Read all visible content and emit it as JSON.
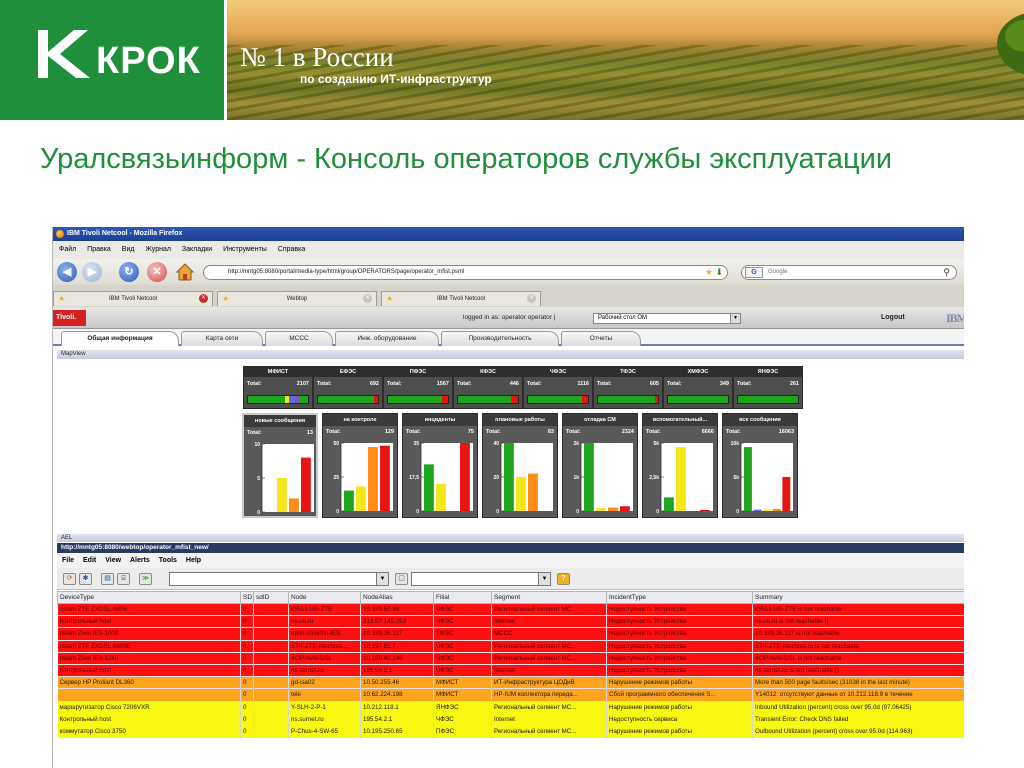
{
  "banner": {
    "logo_text": "КРОК",
    "headline": "№ 1 в России",
    "subline": "по созданию ИТ-инфраструктур"
  },
  "slide_title": "Уралсвязьинформ - Консоль операторов службы эксплуатации",
  "browser": {
    "window_title": "IBM Tivoli Netcool - Mozilla Firefox",
    "menu": [
      "Файл",
      "Правка",
      "Вид",
      "Журнал",
      "Закладки",
      "Инструменты",
      "Справка"
    ],
    "url": "http://mntg05:8080/portal/media-type/html/group/OPERATORS/page/operator_mfist.psml",
    "search_placeholder": "Google",
    "search_badge": "G",
    "tabs": [
      "IBM Tivoli Netcool",
      "Webtop",
      "IBM Tivoli Netcool"
    ]
  },
  "tivoli": {
    "logo": "Tivoli.",
    "login_text": "logged in as: operator operator  |",
    "desktop_select": "Рабочий стол ОМ",
    "logout": "Logout",
    "ibm": "IBM"
  },
  "portal_tabs": [
    "Общая информация",
    "Карта сети",
    "МССС",
    "Инж. оборудование",
    "Производительность",
    "Отчеты"
  ],
  "mapview_title": "MapView",
  "summary_tiles": [
    {
      "name": "МФИСТ",
      "label": "Total:",
      "total": "2107"
    },
    {
      "name": "ЕФЭС",
      "label": "Total:",
      "total": "692"
    },
    {
      "name": "ПФЭС",
      "label": "Total:",
      "total": "1567"
    },
    {
      "name": "КФЭС",
      "label": "Total:",
      "total": "446"
    },
    {
      "name": "ЧФЭС",
      "label": "Total:",
      "total": "1116"
    },
    {
      "name": "ТФЭС",
      "label": "Total:",
      "total": "605"
    },
    {
      "name": "ХМФЭС",
      "label": "Total:",
      "total": "349"
    },
    {
      "name": "ЯНФЭС",
      "label": "Total:",
      "total": "261"
    }
  ],
  "severity_colors": {
    "green": "#1ea61e",
    "yellow": "#f5e61a",
    "orange": "#ff8c14",
    "red": "#e61414",
    "blue": "#5a6ee6",
    "purple": "#9050c0"
  },
  "chart_data": [
    {
      "type": "bar",
      "title": "новые сообщения",
      "total_label": "Total:",
      "total": "13",
      "y_ticks": [
        "10",
        "5",
        "0"
      ],
      "ylim": [
        0,
        10
      ],
      "categories": [
        "green",
        "yellow",
        "orange",
        "red"
      ],
      "values": [
        0,
        5,
        2,
        8
      ]
    },
    {
      "type": "bar",
      "title": "на контроле",
      "total_label": "Total:",
      "total": "129",
      "y_ticks": [
        "50",
        "25",
        "0"
      ],
      "ylim": [
        0,
        50
      ],
      "categories": [
        "green",
        "yellow",
        "orange",
        "red"
      ],
      "values": [
        15,
        18,
        47,
        48
      ]
    },
    {
      "type": "bar",
      "title": "инциденты",
      "total_label": "Total:",
      "total": "75",
      "y_ticks": [
        "35",
        "17,5",
        "0"
      ],
      "ylim": [
        0,
        35
      ],
      "categories": [
        "green",
        "yellow",
        "orange",
        "red"
      ],
      "values": [
        24,
        14,
        0,
        35
      ]
    },
    {
      "type": "bar",
      "title": "плановые работы",
      "total_label": "Total:",
      "total": "83",
      "y_ticks": [
        "40",
        "20",
        "0"
      ],
      "ylim": [
        0,
        40
      ],
      "categories": [
        "green",
        "yellow",
        "orange",
        "red"
      ],
      "values": [
        40,
        20,
        22,
        0
      ]
    },
    {
      "type": "bar",
      "title": "отладка СМ",
      "total_label": "Total:",
      "total": "2324",
      "y_ticks": [
        "2k",
        "1k",
        "0"
      ],
      "ylim": [
        0,
        2000
      ],
      "categories": [
        "green",
        "yellow",
        "orange",
        "red"
      ],
      "values": [
        2000,
        80,
        100,
        140
      ]
    },
    {
      "type": "bar",
      "title": "вспомогательный...",
      "total_label": "Total:",
      "total": "6666",
      "y_ticks": [
        "5k",
        "2,5k",
        "0"
      ],
      "ylim": [
        0,
        5000
      ],
      "categories": [
        "green",
        "yellow",
        "orange",
        "red"
      ],
      "values": [
        1000,
        4700,
        0,
        50
      ]
    },
    {
      "type": "bar",
      "title": "все сообщения",
      "total_label": "Total:",
      "total": "16063",
      "y_ticks": [
        "10k",
        "5k",
        "0"
      ],
      "ylim": [
        0,
        10000
      ],
      "categories": [
        "green",
        "blue",
        "yellow",
        "orange",
        "red"
      ],
      "values": [
        9400,
        200,
        200,
        300,
        5000
      ]
    }
  ],
  "ael": {
    "title": "AEL",
    "url": "http://mntg05:8080/webtop/operator_mfist_new/",
    "menu": [
      "File",
      "Edit",
      "View",
      "Alerts",
      "Tools",
      "Help"
    ],
    "columns": [
      "DeviceType",
      "SD",
      "sdID",
      "Node",
      "NodeAlias",
      "Filial",
      "Segment",
      "IncidentType",
      "Summary"
    ],
    "rows": [
      {
        "severity": "red",
        "cells": [
          "dslam ZTE ZXDSL-9806",
          "0",
          "",
          "KRA-LUG-ZTE",
          "10.199.50.98",
          "ЧФЭС",
          "Региональный сегмент МС...",
          "Недоступность Устройства",
          "KRA-LUG-ZTE is not reachable"
        ]
      },
      {
        "severity": "red",
        "cells": [
          "Контрольный host",
          "0",
          "",
          "ns.uu.ru",
          "213.57.145.253",
          "ЧФЭС",
          "Internet",
          "Недоступность Устройства",
          "ns.uu.ru is not reachable ()"
        ]
      },
      {
        "severity": "red",
        "cells": [
          "dslam Zixel IES-1000",
          "0",
          "",
          "upsh-smurtlin-IES...",
          "10.199.36.117",
          "ТФЭС",
          "МССС",
          "Недоступность Устройства",
          "10.199.36.117 is not reachable"
        ]
      },
      {
        "severity": "red",
        "cells": [
          "dslam ZTE ZXDSL-9606E",
          "0",
          "",
          "STK-ZTE-Mezhrev...",
          "10.197.81.7",
          "ЧФЭС",
          "Региональный сегмент МС...",
          "Недоступность Устройства",
          "STK-ZTE-Mezhrev.ru is not reachable"
        ]
      },
      {
        "severity": "red",
        "cells": [
          "dslam Zixel IES-1248",
          "0",
          "",
          "AOP-NAV-DSL",
          "10.199.40.146",
          "ЧФЭС",
          "Региональный сегмент МС...",
          "Недоступность Устройства",
          "AOP-NAV-DSL is not reachable"
        ]
      },
      {
        "severity": "red",
        "cells": [
          "Контрольный host",
          "0",
          "",
          "ns.surnet.ru",
          "195.54.2.1",
          "ЧФЭС",
          "Internet",
          "Недоступность Устройства",
          "ns.surnet.ru is not reachable ()"
        ]
      },
      {
        "severity": "orange",
        "cells": [
          "Сервер HP Proliant DL360",
          "0",
          "",
          "gd-isa02",
          "10.50.255.46",
          "МФИСТ",
          "ИТ-Инфраструктура ЦОДиВ",
          "Нарушение режимов работы",
          "More than 500 page faults/sec (31038 in the last minute)"
        ]
      },
      {
        "severity": "orange",
        "cells": [
          "",
          "0",
          "",
          "tele",
          "10.62.224.198",
          "МФИСТ",
          "HP-IUM коллектора переда...",
          "Сбой программного обеспечения S...",
          "Y14012: отсутствуют данные от 10.212.118.9 в течение"
        ]
      },
      {
        "severity": "yellow",
        "cells": [
          "маршрутизатор Cisco 7206VXR",
          "0",
          "",
          "Y-SLH-2-P-1",
          "10.212.118.1",
          "ЯНФЭС",
          "Региональный сегмент МС...",
          "Нарушение режимов работы",
          "Inbound Utilization (percent) cross over 95.0d (97.06425)"
        ]
      },
      {
        "severity": "yellow",
        "cells": [
          "Контрольный host",
          "0",
          "",
          "ns.surnet.ru",
          "195.54.2.1",
          "ЧФЭС",
          "Internet",
          "Недоступность сервиса",
          "Transient Error: Check DNS failed"
        ]
      },
      {
        "severity": "yellow",
        "cells": [
          "коммутатор Cisco 3750",
          "0",
          "",
          "P-Chus-4-SW-65",
          "10.195.250.65",
          "ПФЭС",
          "Региональный сегмент МС...",
          "Нарушение режимов работы",
          "Outbound Utilization (percent) cross over 95.0d (114.963)"
        ]
      }
    ]
  }
}
